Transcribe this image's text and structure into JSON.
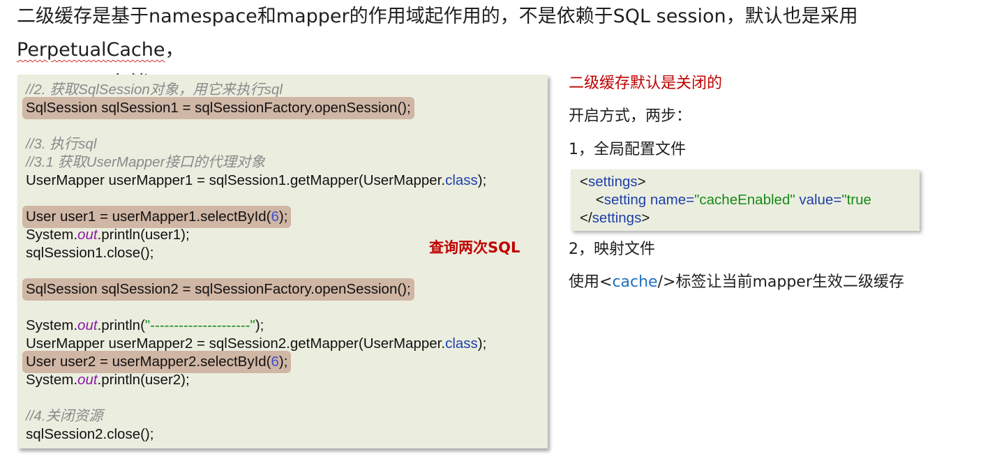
{
  "heading": {
    "line1_main": "二级缓存是基于namespace和mapper的作用域起作用的，不是依赖于SQL session，默认也是采用 ",
    "line1_term": "PerpetualCache",
    "line1_end": "，",
    "line2": "HashMap 存储"
  },
  "code": {
    "c1": "//2. 获取SqlSession对象，用它来执行sql",
    "l_open1": "SqlSession sqlSession1 = sqlSessionFactory.openSession();",
    "c2": "//3. 执行sql",
    "c3": "//3.1 获取UserMapper接口的代理对象",
    "l_getm1_a": "UserMapper userMapper1 = sqlSession1.getMapper(UserMapper.",
    "l_class": "class",
    "l_getm_b": ");",
    "l_sel1_a": "User user1 = userMapper1.selectById(",
    "l_num": "6",
    "l_sel_b": ");",
    "l_sys_a": "System.",
    "l_out": "out",
    "l_print1_b": ".println(user1);",
    "l_close1": "sqlSession1.close();",
    "l_open2": "SqlSession sqlSession2 = sqlSessionFactory.openSession();",
    "l_print_sep_a": ".println(",
    "l_sep_str": "\"---------------------\"",
    "l_print_sep_b": ");",
    "l_getm2_a": "UserMapper userMapper2 = sqlSession2.getMapper(UserMapper.",
    "l_sel2_a": "User user2 = userMapper2.selectById(",
    "l_print2_b": ".println(user2);",
    "c4": "//4.关闭资源",
    "l_close2": "sqlSession2.close();"
  },
  "annotation": {
    "query_twice": "查询两次SQL"
  },
  "side": {
    "default_closed": "二级缓存默认是关闭的",
    "enable_steps": "开启方式，两步：",
    "step1": "1，全局配置文件",
    "step2": "2，映射文件",
    "usage_pre": "使用<",
    "usage_tag": "cache",
    "usage_post": "/>标签让当前mapper生效二级缓存"
  },
  "xml": {
    "open_lt": "<",
    "settings": "settings",
    "gt": ">",
    "setting_indent": "    <",
    "setting": "setting",
    "name_attr": " name=",
    "name_val": "\"cacheEnabled\"",
    "value_attr": " value=",
    "value_val": "\"true",
    "close_lt": "</"
  },
  "colors": {
    "annotation_red": "#c00000",
    "code_bg": "#ebeedf",
    "highlight": "#d0b6a5",
    "keyword_blue": "#1f3fa8",
    "string_green": "#178a17",
    "out_purple": "#8a1aa8"
  }
}
